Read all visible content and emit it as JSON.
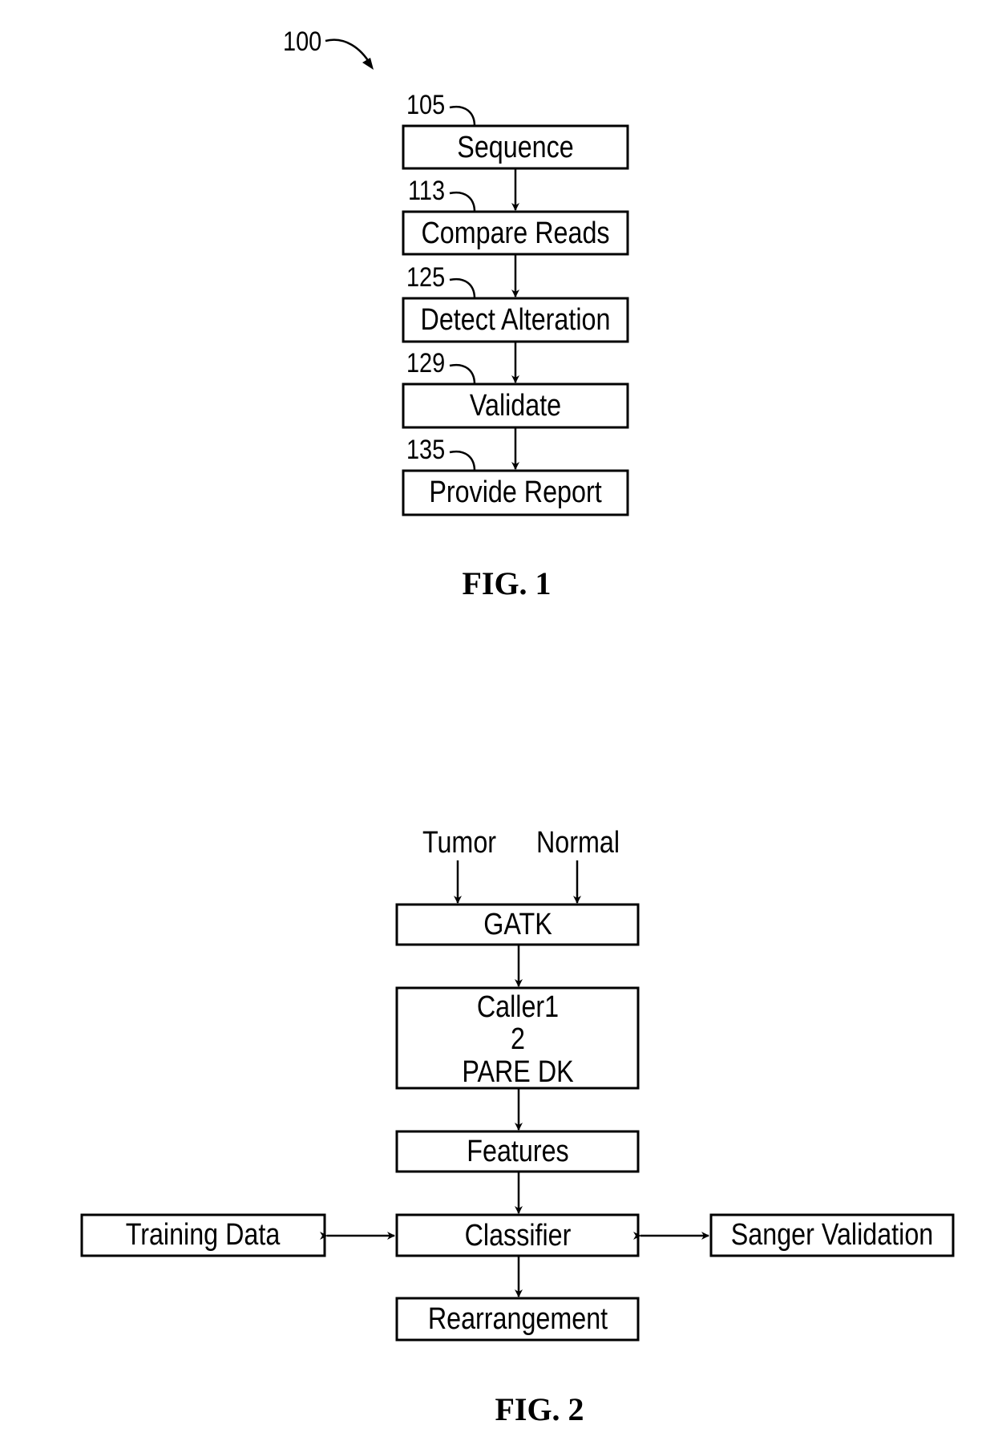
{
  "figure1": {
    "ref_number": "100",
    "caption": "FIG. 1",
    "steps": [
      {
        "ref": "105",
        "label": "Sequence"
      },
      {
        "ref": "113",
        "label": "Compare Reads"
      },
      {
        "ref": "125",
        "label": "Detect Alteration"
      },
      {
        "ref": "129",
        "label": "Validate"
      },
      {
        "ref": "135",
        "label": "Provide Report"
      }
    ]
  },
  "figure2": {
    "caption": "FIG. 2",
    "inputs": [
      "Tumor",
      "Normal"
    ],
    "gatk": "GATK",
    "callers": [
      "Caller1",
      "2",
      "PARE DK"
    ],
    "features": "Features",
    "classifier": "Classifier",
    "training_data": "Training Data",
    "sanger_validation": "Sanger Validation",
    "output": "Rearrangement"
  }
}
